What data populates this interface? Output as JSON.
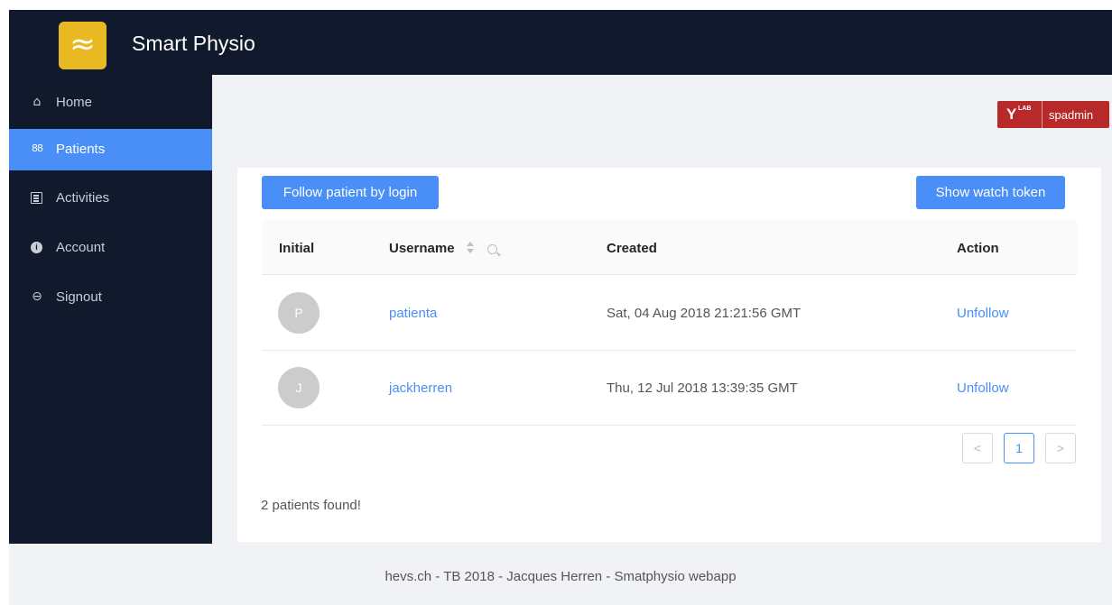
{
  "app": {
    "logo_glyph": "≈",
    "title": "Smart Physio"
  },
  "sidebar": {
    "items": [
      {
        "label": "Home",
        "icon": "home-icon",
        "active": false
      },
      {
        "label": "Patients",
        "icon": "patients-icon",
        "active": true
      },
      {
        "label": "Activities",
        "icon": "list-icon",
        "active": false
      },
      {
        "label": "Account",
        "icon": "info-icon",
        "active": false
      },
      {
        "label": "Signout",
        "icon": "signout-icon",
        "active": false
      }
    ]
  },
  "user_badge": {
    "logo_y": "Y",
    "logo_lab": "LAB",
    "username": "spadmin",
    "color": "#b82a2a"
  },
  "toolbar": {
    "follow_label": "Follow patient by login",
    "token_label": "Show watch token"
  },
  "table": {
    "columns": [
      "Initial",
      "Username",
      "Created",
      "Action"
    ],
    "rows": [
      {
        "initial": "P",
        "username": "patienta",
        "created": "Sat, 04 Aug 2018 21:21:56 GMT",
        "action": "Unfollow"
      },
      {
        "initial": "J",
        "username": "jackherren",
        "created": "Thu, 12 Jul 2018 13:39:35 GMT",
        "action": "Unfollow"
      }
    ]
  },
  "pagination": {
    "prev": "<",
    "current": "1",
    "next": ">"
  },
  "status": {
    "found_text": "2 patients found!"
  },
  "footer": {
    "text": "hevs.ch - TB 2018 - Jacques Herren - Smatphysio webapp"
  },
  "colors": {
    "header_bg": "#111a2c",
    "accent": "#4a8ff7",
    "logo_bg": "#e8b923"
  }
}
